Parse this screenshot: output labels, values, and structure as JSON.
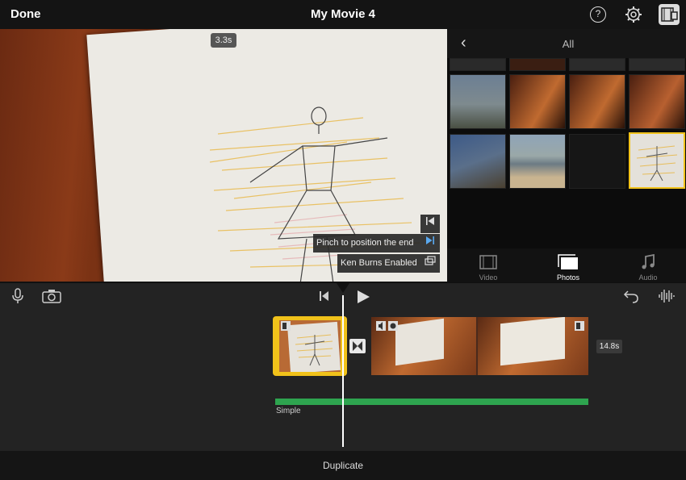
{
  "topbar": {
    "done_label": "Done",
    "title": "My Movie 4",
    "help_glyph": "?",
    "icons": [
      "help-icon",
      "settings-icon",
      "project-settings-icon"
    ]
  },
  "viewer": {
    "time_badge": "3.3s",
    "tooltips": {
      "pinch_label": "Pinch to position the end",
      "ken_burns_label": "Ken Burns Enabled"
    }
  },
  "browser": {
    "title": "All",
    "tabs": [
      {
        "label": "Video",
        "icon": "filmstrip-icon"
      },
      {
        "label": "Photos",
        "icon": "photos-icon"
      },
      {
        "label": "Audio",
        "icon": "music-note-icon"
      }
    ],
    "selected_tab": "Photos"
  },
  "timeline": {
    "clip_duration": "14.8s",
    "audio_track_label": "Simple"
  },
  "bottom": {
    "duplicate_label": "Duplicate"
  },
  "colors": {
    "accent_yellow": "#f1c21a",
    "audio_green": "#2ea44f",
    "background": "#232323"
  }
}
